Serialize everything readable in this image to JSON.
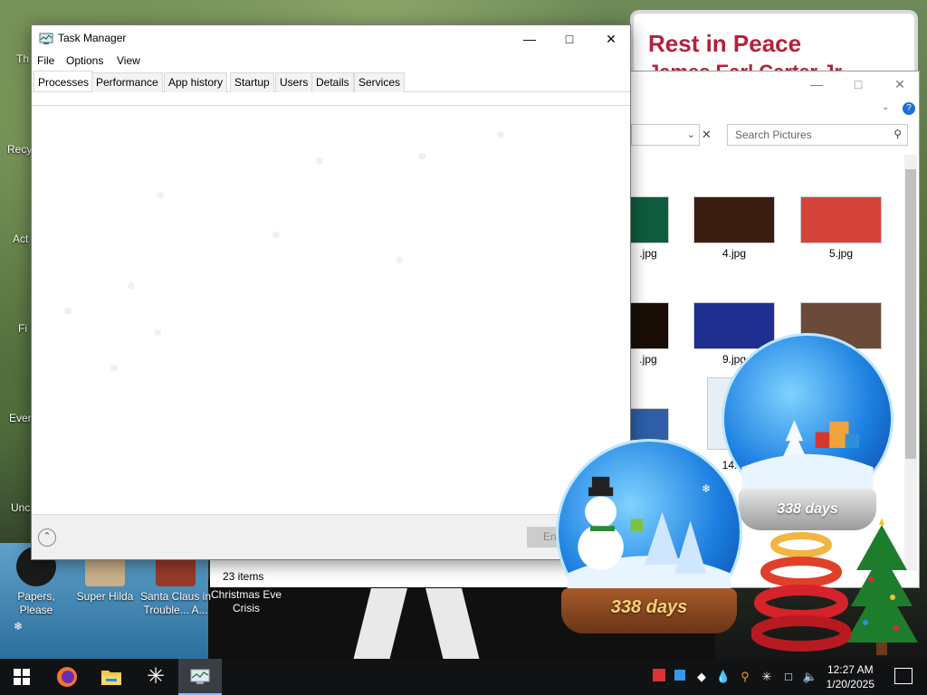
{
  "desktop": {
    "billboard_line1": "Rest in Peace",
    "billboard_line2": "James Earl Carter Jr",
    "left_labels": [
      "Th",
      "Recy",
      "Act",
      "Fi",
      "Ever",
      "Unc"
    ],
    "icons": [
      {
        "label": "Papers, Please",
        "color": "#1b1b1b"
      },
      {
        "label": "Super Hilda",
        "color": "#c9b08a"
      },
      {
        "label": "Santa Claus in Trouble... A...",
        "color": "#9a3b2a"
      },
      {
        "label": "Christmas Eve Crisis",
        "color": "#2b2b2b"
      }
    ]
  },
  "explorer": {
    "search_placeholder": "Search Pictures",
    "status": "23 items",
    "thumbnails": [
      {
        "label": ".jpg",
        "color": "#0f5c3e"
      },
      {
        "label": "4.jpg",
        "color": "#3b1e10"
      },
      {
        "label": "5.jpg",
        "color": "#d6433a"
      },
      {
        "label": ".jpg",
        "color": "#1a0d08"
      },
      {
        "label": "9.jpg",
        "color": "#1e2f8f"
      },
      {
        "label": "",
        "color": "#6b4a3a"
      },
      {
        "label": "",
        "color": "#2f5fa8"
      },
      {
        "label": "14.",
        "color": "#e8eef6"
      }
    ]
  },
  "task_manager": {
    "title": "Task Manager",
    "menu": [
      "File",
      "Options",
      "View"
    ],
    "tabs": [
      "Processes",
      "Performance",
      "App history",
      "Startup",
      "Users",
      "Details",
      "Services"
    ],
    "active_tab": "Processes",
    "end_task_label": "End task"
  },
  "globes": {
    "front_days": "338 days",
    "back_days": "338 days"
  },
  "taskbar": {
    "time": "12:27 AM",
    "date": "1/20/2025"
  },
  "colors": {
    "accent": "#8cb8ff",
    "billboard_text": "#b3213a",
    "taskbar": "#101214"
  }
}
